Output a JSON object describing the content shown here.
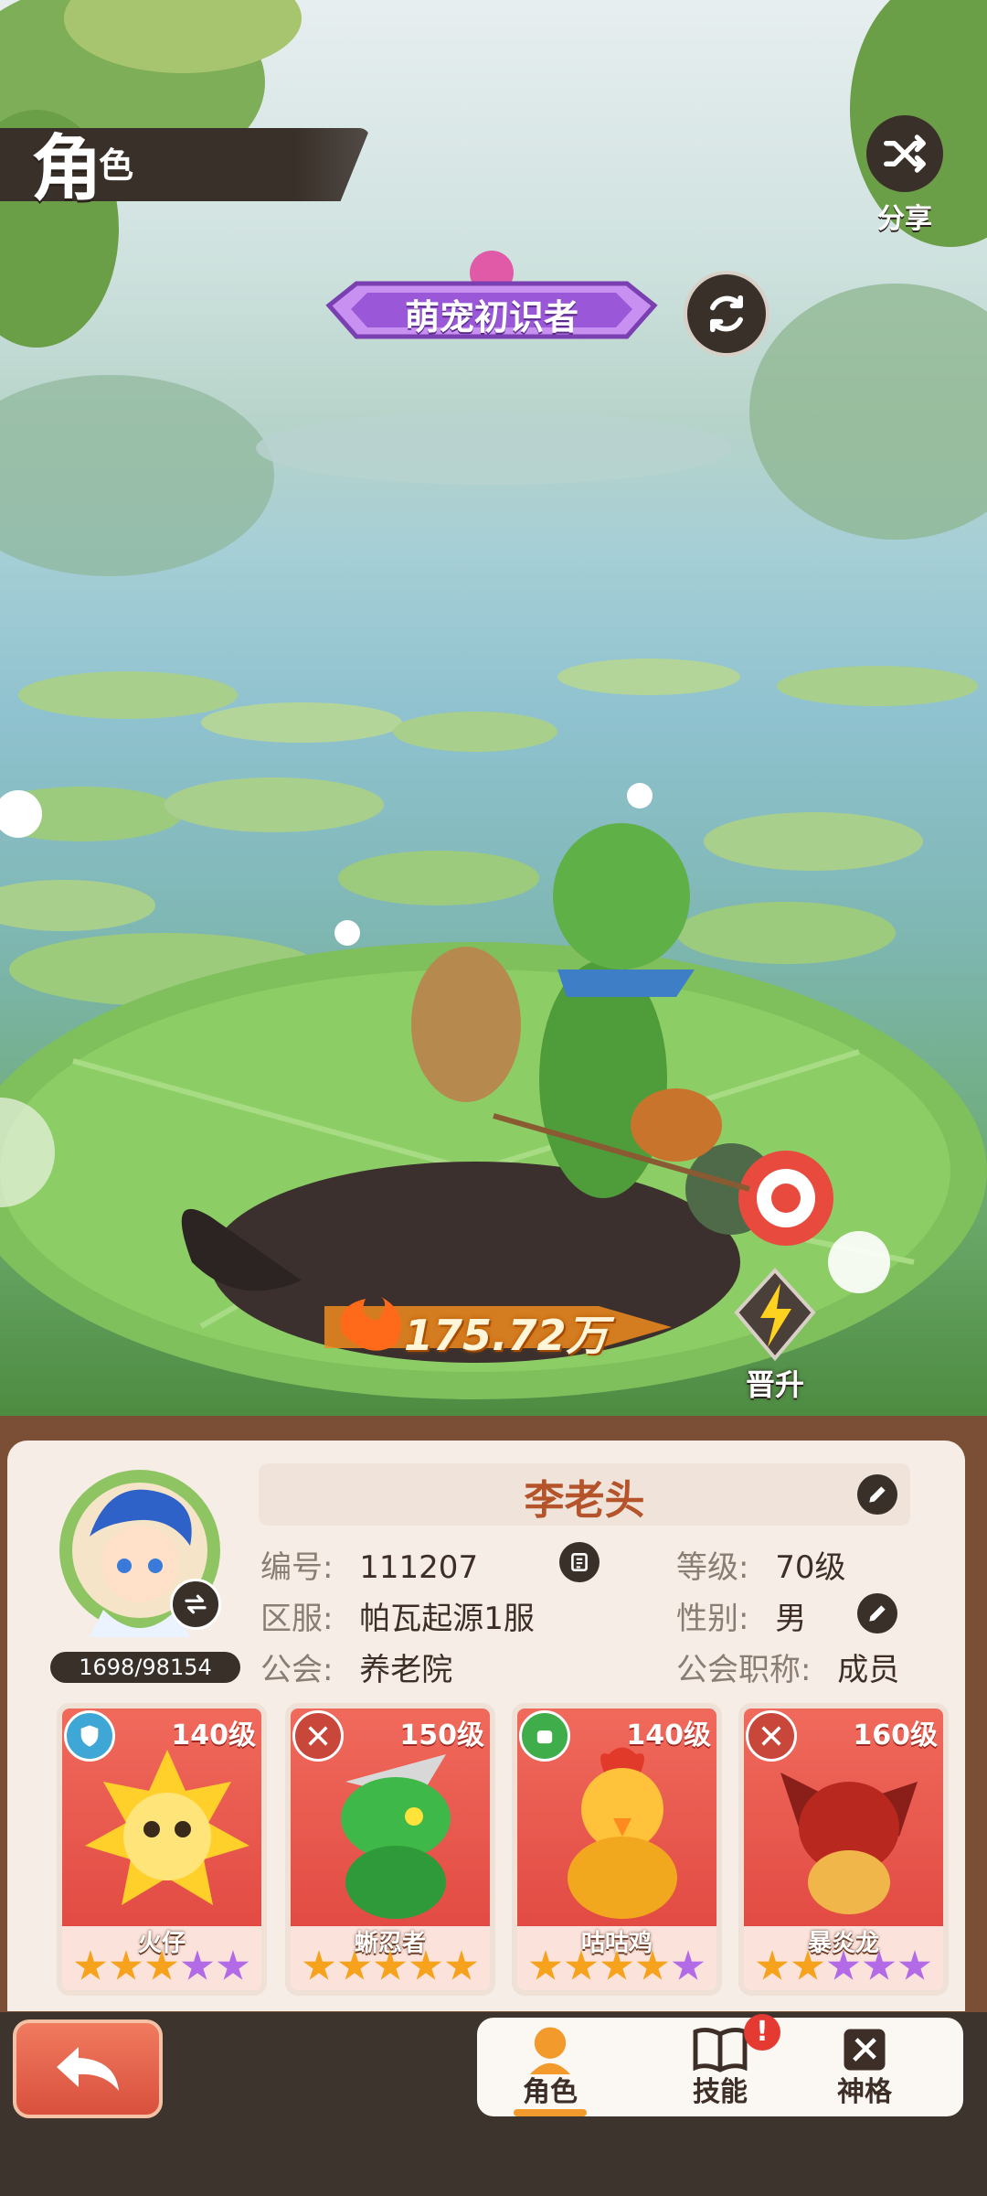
{
  "header": {
    "title_big": "角",
    "title_small": "色",
    "share_label": "分享"
  },
  "badge": {
    "label": "萌宠初识者"
  },
  "character": {
    "power": "175.72万",
    "promote_label": "晋升"
  },
  "profile": {
    "name": "李老头",
    "exp": "1698/98154",
    "id_label": "编号:",
    "id_value": "111207",
    "server_label": "区服:",
    "server_value": "帕瓦起源1服",
    "guild_label": "公会:",
    "guild_value": "养老院",
    "level_label": "等级:",
    "level_value": "70级",
    "gender_label": "性别:",
    "gender_value": "男",
    "role_label": "公会职称:",
    "role_value": "成员"
  },
  "pets": [
    {
      "name": "火仔",
      "level": "140级",
      "element_icon": "shield-icon",
      "element_color": "#3fa7d6",
      "stars": [
        "g",
        "g",
        "g",
        "p",
        "p"
      ]
    },
    {
      "name": "蜥忍者",
      "level": "150级",
      "element_icon": "swords-icon",
      "element_color": "#c8463a",
      "stars": [
        "g",
        "g",
        "g",
        "g",
        "g"
      ]
    },
    {
      "name": "咕咕鸡",
      "level": "140级",
      "element_icon": "fist-icon",
      "element_color": "#3fae4a",
      "stars": [
        "g",
        "g",
        "g",
        "g",
        "p"
      ]
    },
    {
      "name": "暴炎龙",
      "level": "160级",
      "element_icon": "swords-icon",
      "element_color": "#c8463a",
      "stars": [
        "g",
        "g",
        "p",
        "p",
        "p"
      ]
    }
  ],
  "tabs": [
    {
      "label": "角色",
      "active": true
    },
    {
      "label": "技能",
      "notice": "!"
    },
    {
      "label": "神格"
    }
  ],
  "colors": {
    "accent": "#f39a2c",
    "name": "#b5532a",
    "panel": "#f6eee6"
  }
}
